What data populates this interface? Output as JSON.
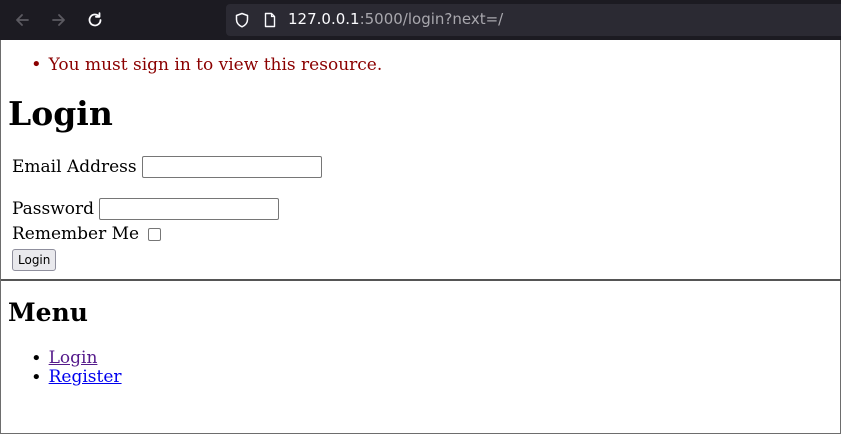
{
  "browser": {
    "url_host": "127.0.0.1",
    "url_rest": ":5000/login?next=/",
    "icons": [
      "back-arrow-icon",
      "forward-arrow-icon",
      "reload-icon",
      "shield-icon",
      "page-icon"
    ]
  },
  "page": {
    "flash_message": "You must sign in to view this resource.",
    "title": "Login",
    "form": {
      "email_label": "Email Address",
      "email_value": "",
      "password_label": "Password",
      "password_value": "",
      "remember_label": "Remember Me",
      "remember_checked": false,
      "submit_label": "Login"
    },
    "menu": {
      "title": "Menu",
      "items": [
        {
          "label": "Login"
        },
        {
          "label": "Register"
        }
      ]
    }
  },
  "colors": {
    "flash": "#8b0000",
    "link": "#0000ee",
    "visited_link": "#551a8b",
    "toolbar": "#1c1b22",
    "urlbar": "#2b2a33"
  }
}
